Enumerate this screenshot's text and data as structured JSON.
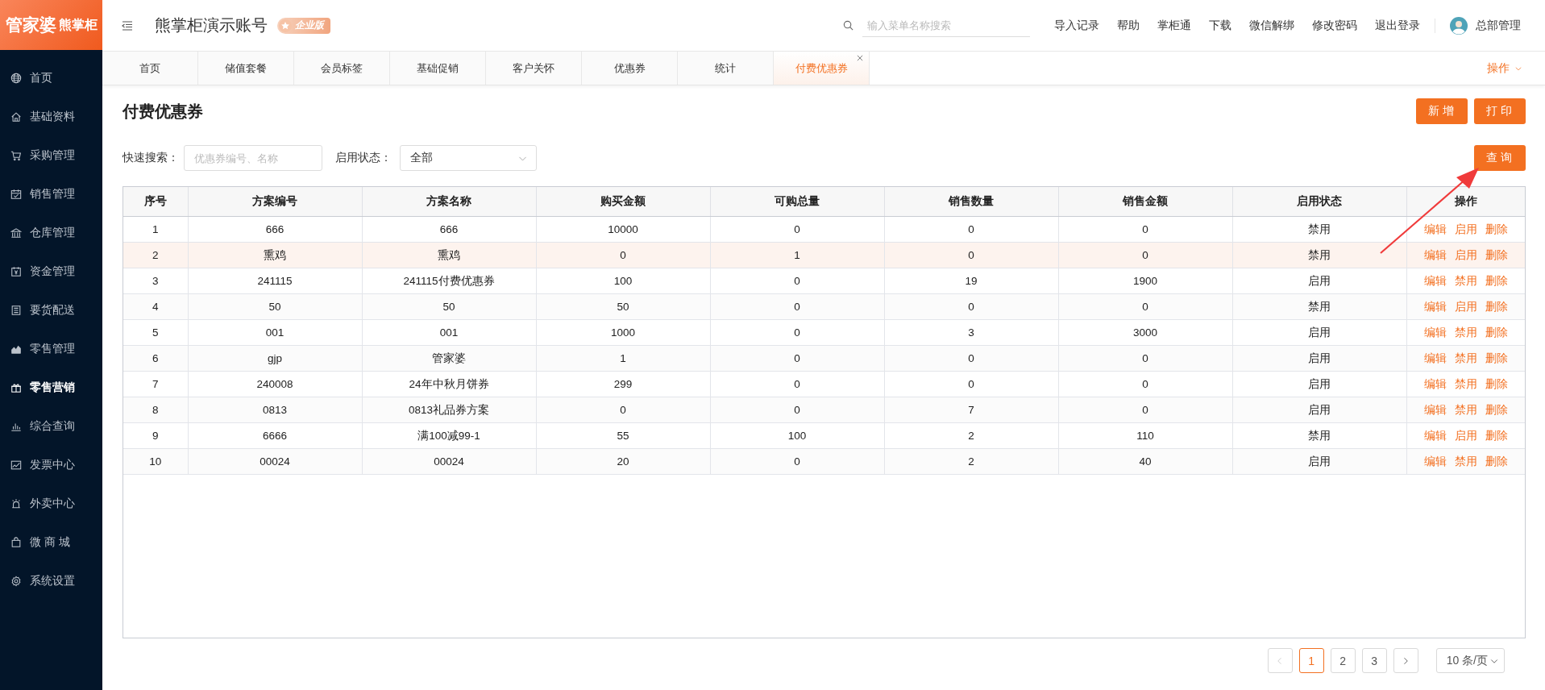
{
  "logo": {
    "brand": "管家婆",
    "product": "熊掌柜"
  },
  "header": {
    "account": "熊掌柜演示账号",
    "edition": "企业版",
    "search": {
      "placeholder": "输入菜单名称搜索"
    },
    "links": [
      "导入记录",
      "帮助",
      "掌柜通",
      "下载",
      "微信解绑",
      "修改密码",
      "退出登录"
    ],
    "user": "总部管理"
  },
  "sidebar": {
    "items": [
      {
        "label": "首页",
        "selected": false
      },
      {
        "label": "基础资料",
        "selected": false
      },
      {
        "label": "采购管理",
        "selected": false
      },
      {
        "label": "销售管理",
        "selected": false
      },
      {
        "label": "仓库管理",
        "selected": false
      },
      {
        "label": "资金管理",
        "selected": false
      },
      {
        "label": "要货配送",
        "selected": false
      },
      {
        "label": "零售管理",
        "selected": false
      },
      {
        "label": "零售营销",
        "selected": true
      },
      {
        "label": "综合查询",
        "selected": false
      },
      {
        "label": "发票中心",
        "selected": false
      },
      {
        "label": "外卖中心",
        "selected": false
      },
      {
        "label": "微 商 城",
        "selected": false
      },
      {
        "label": "系统设置",
        "selected": false
      }
    ]
  },
  "tabs": [
    {
      "label": "首页",
      "selected": false
    },
    {
      "label": "储值套餐",
      "selected": false
    },
    {
      "label": "会员标签",
      "selected": false
    },
    {
      "label": "基础促销",
      "selected": false
    },
    {
      "label": "客户关怀",
      "selected": false
    },
    {
      "label": "优惠券",
      "selected": false
    },
    {
      "label": "统计",
      "selected": false
    },
    {
      "label": "付费优惠券",
      "selected": true
    }
  ],
  "tab_menu": "操作",
  "page": {
    "title": "付费优惠券",
    "buttons": [
      "新增",
      "打印"
    ],
    "filters": {
      "search_label": "快速搜索：",
      "search_placeholder": "优惠券编号、名称",
      "status_label": "启用状态：",
      "status_value": "全部"
    },
    "query_button": "查询"
  },
  "table": {
    "columns": [
      "序号",
      "方案编号",
      "方案名称",
      "购买金额",
      "可购总量",
      "销售数量",
      "销售金额",
      "启用状态",
      "操作"
    ],
    "rows": [
      {
        "cells": [
          "1",
          "666",
          "666",
          "10000",
          "0",
          "0",
          "0",
          "禁用"
        ],
        "actions": [
          "编辑",
          "启用",
          "删除"
        ],
        "selected": false
      },
      {
        "cells": [
          "2",
          "熏鸡",
          "熏鸡",
          "0",
          "1",
          "0",
          "0",
          "禁用"
        ],
        "actions": [
          "编辑",
          "启用",
          "删除"
        ],
        "selected": true
      },
      {
        "cells": [
          "3",
          "241115",
          "241115付费优惠券",
          "100",
          "0",
          "19",
          "1900",
          "启用"
        ],
        "actions": [
          "编辑",
          "禁用",
          "删除"
        ],
        "selected": false
      },
      {
        "cells": [
          "4",
          "50",
          "50",
          "50",
          "0",
          "0",
          "0",
          "禁用"
        ],
        "actions": [
          "编辑",
          "启用",
          "删除"
        ],
        "selected": false
      },
      {
        "cells": [
          "5",
          "001",
          "001",
          "1000",
          "0",
          "3",
          "3000",
          "启用"
        ],
        "actions": [
          "编辑",
          "禁用",
          "删除"
        ],
        "selected": false
      },
      {
        "cells": [
          "6",
          "gjp",
          "管家婆",
          "1",
          "0",
          "0",
          "0",
          "启用"
        ],
        "actions": [
          "编辑",
          "禁用",
          "删除"
        ],
        "selected": false
      },
      {
        "cells": [
          "7",
          "240008",
          "24年中秋月饼券",
          "299",
          "0",
          "0",
          "0",
          "启用"
        ],
        "actions": [
          "编辑",
          "禁用",
          "删除"
        ],
        "selected": false
      },
      {
        "cells": [
          "8",
          "0813",
          "0813礼品券方案",
          "0",
          "0",
          "7",
          "0",
          "启用"
        ],
        "actions": [
          "编辑",
          "禁用",
          "删除"
        ],
        "selected": false
      },
      {
        "cells": [
          "9",
          "6666",
          "满100减99-1",
          "55",
          "100",
          "2",
          "110",
          "禁用"
        ],
        "actions": [
          "编辑",
          "启用",
          "删除"
        ],
        "selected": false
      },
      {
        "cells": [
          "10",
          "00024",
          "00024",
          "20",
          "0",
          "2",
          "40",
          "启用"
        ],
        "actions": [
          "编辑",
          "禁用",
          "删除"
        ],
        "selected": false
      }
    ]
  },
  "pagination": {
    "pages": [
      {
        "label": "1",
        "selected": true
      },
      {
        "label": "2",
        "selected": false
      },
      {
        "label": "3",
        "selected": false
      }
    ],
    "page_size": "10 条/页"
  }
}
